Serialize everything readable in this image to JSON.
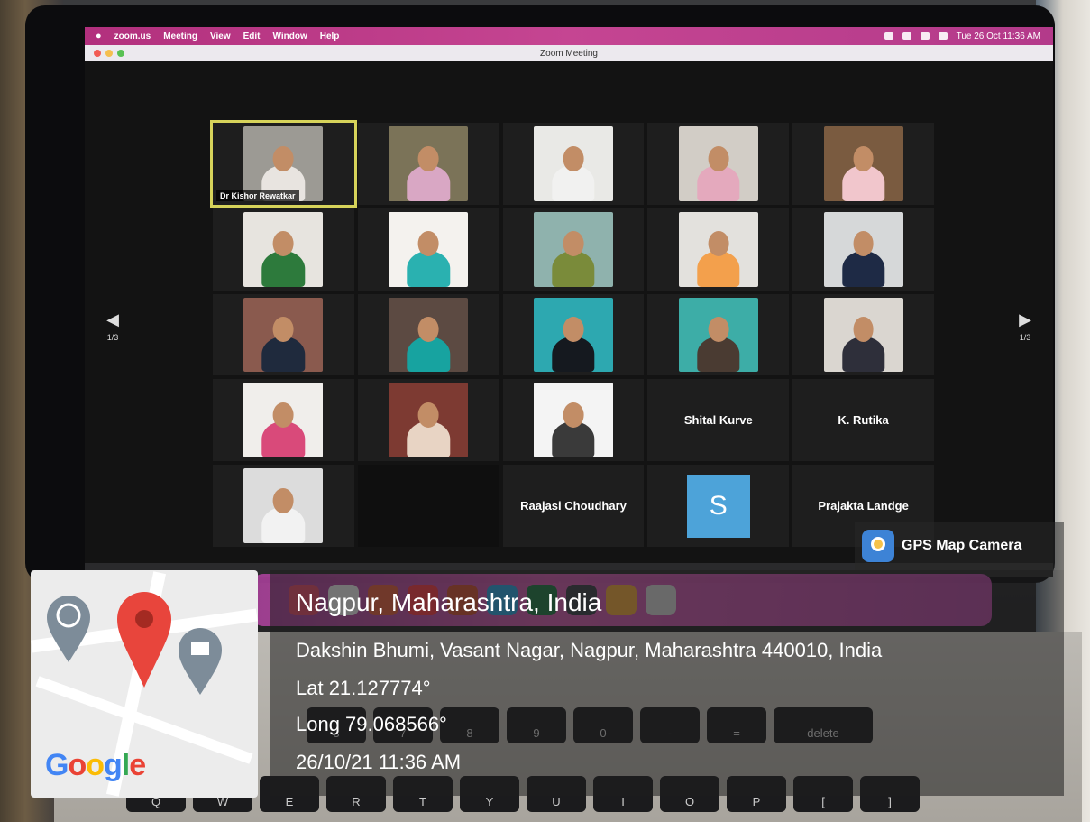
{
  "menubar": {
    "app": "zoom.us",
    "items": [
      "Meeting",
      "View",
      "Edit",
      "Window",
      "Help"
    ],
    "clock": "Tue 26 Oct 11:36 AM"
  },
  "window": {
    "title": "Zoom Meeting"
  },
  "pager": {
    "left_label": "1/3",
    "right_label": "1/3"
  },
  "tiles": [
    {
      "type": "video",
      "label": "Dr Kishor Rewatkar",
      "active": true,
      "bg": "#9c9a94",
      "shirt": "#e8e4e0"
    },
    {
      "type": "video",
      "bg": "#7b7358",
      "shirt": "#d9a7c4"
    },
    {
      "type": "video",
      "bg": "#e9e9e6",
      "shirt": "#f1f1f0"
    },
    {
      "type": "video",
      "bg": "#d2cdc6",
      "shirt": "#e4a9bd"
    },
    {
      "type": "video",
      "bg": "#7a5b40",
      "shirt": "#f1c6cc"
    },
    {
      "type": "video",
      "bg": "#e7e4df",
      "shirt": "#2d7a3c"
    },
    {
      "type": "video",
      "bg": "#f4f2ee",
      "shirt": "#2ab1b0"
    },
    {
      "type": "video",
      "bg": "#8fb2ad",
      "shirt": "#7a8b3a"
    },
    {
      "type": "video",
      "bg": "#e3e1dd",
      "shirt": "#f3a04c"
    },
    {
      "type": "video",
      "bg": "#d6d8d9",
      "shirt": "#1e2a45"
    },
    {
      "type": "video",
      "bg": "#8a5a4e",
      "shirt": "#1f2a3d"
    },
    {
      "type": "video",
      "bg": "#5c4a42",
      "shirt": "#17a3a0"
    },
    {
      "type": "video",
      "bg": "#2da8b0",
      "shirt": "#15191f"
    },
    {
      "type": "video",
      "bg": "#3dada7",
      "shirt": "#4a3b32"
    },
    {
      "type": "video",
      "bg": "#dad6d0",
      "shirt": "#2e2f3a"
    },
    {
      "type": "video",
      "bg": "#f0eeeb",
      "shirt": "#d94a7a"
    },
    {
      "type": "video",
      "bg": "#7d3a32",
      "shirt": "#e8d4c4"
    },
    {
      "type": "video",
      "bg": "#f4f4f4",
      "shirt": "#3a3a3a"
    },
    {
      "type": "name",
      "label": "Shital Kurve"
    },
    {
      "type": "name",
      "label": "K. Rutika"
    },
    {
      "type": "video",
      "bg": "#dcdcdc",
      "shirt": "#f2f2f2"
    },
    {
      "type": "blank"
    },
    {
      "type": "name",
      "label": "Raajasi Choudhary"
    },
    {
      "type": "avatar",
      "letter": "S"
    },
    {
      "type": "name",
      "label": "Prajakta Landge"
    }
  ],
  "gps": {
    "badge": "GPS Map Camera",
    "place": "Nagpur, Maharashtra, India",
    "address": "Dakshin Bhumi, Vasant Nagar, Nagpur, Maharashtra 440010, India",
    "lat": "Lat 21.127774°",
    "long": "Long 79.068566°",
    "datetime": "26/10/21 11:36 AM",
    "map_brand": "Google"
  },
  "keyboard": {
    "row1": [
      "#\n3",
      "&\n7",
      "*\n8",
      "(\n9",
      ")\n0",
      "—",
      "+\n=",
      "delete"
    ],
    "row2": [
      "Q",
      "W",
      "E",
      "R",
      "T",
      "Y",
      "U",
      "I",
      "O",
      "P",
      "{",
      "}"
    ]
  }
}
